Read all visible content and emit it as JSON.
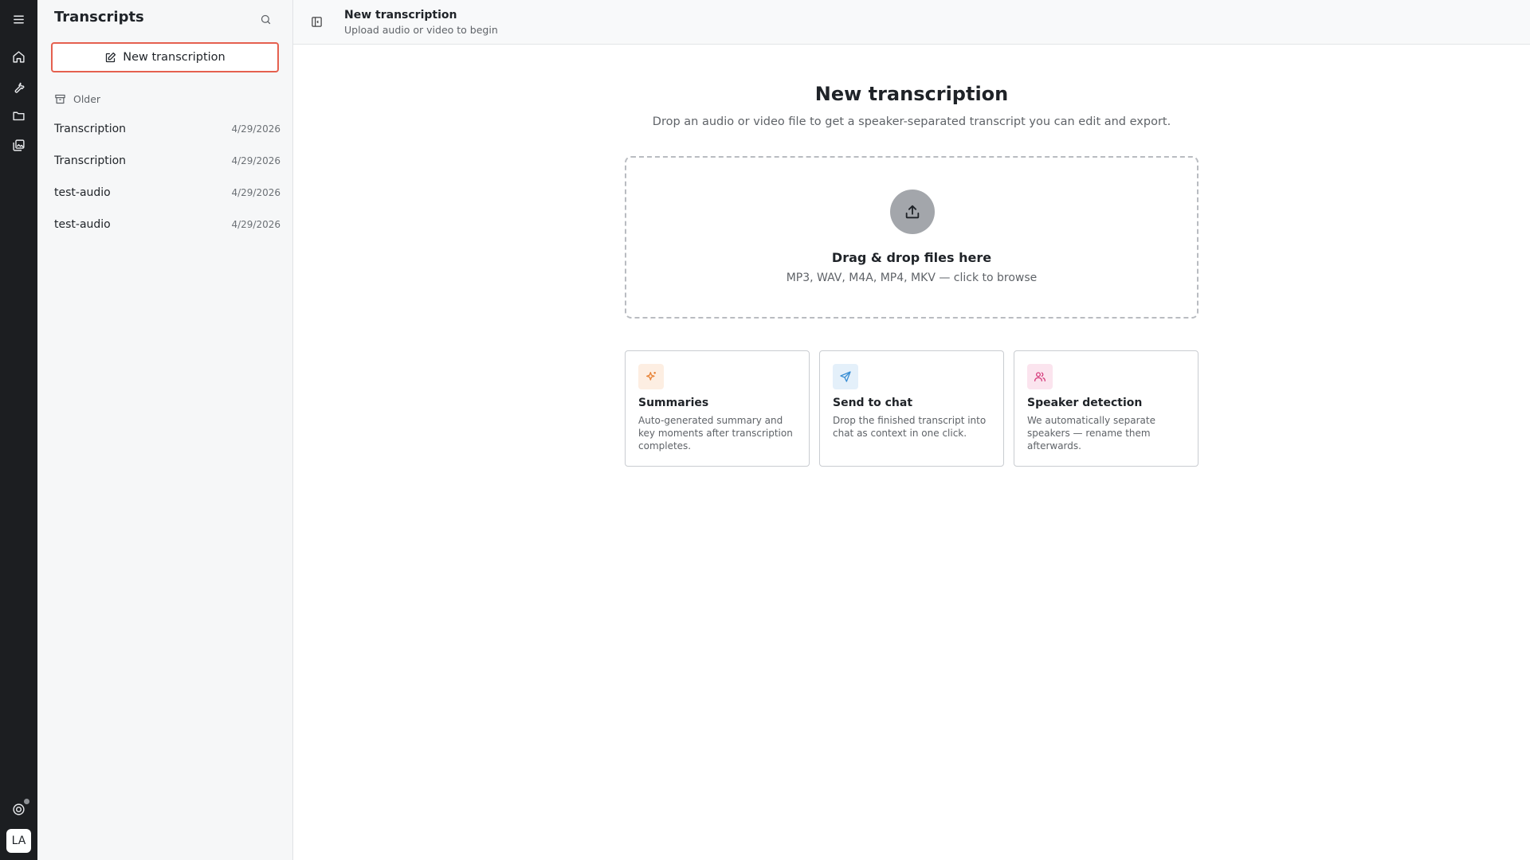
{
  "rail": {
    "icons": [
      "menu-icon",
      "home-icon",
      "tools-icon",
      "folder-icon",
      "gallery-icon",
      "support-icon"
    ],
    "avatar_initials": "LA"
  },
  "sidebar": {
    "title": "Transcripts",
    "new_button_label": "New transcription",
    "group_label": "Older",
    "items": [
      {
        "name": "Transcription",
        "date": "4/29/2026"
      },
      {
        "name": "Transcription",
        "date": "4/29/2026"
      },
      {
        "name": "test-audio",
        "date": "4/29/2026"
      },
      {
        "name": "test-audio",
        "date": "4/29/2026"
      }
    ]
  },
  "header": {
    "title": "New transcription",
    "subtitle": "Upload audio or video to begin"
  },
  "main": {
    "title": "New transcription",
    "subtitle": "Drop an audio or video file to get a speaker-separated transcript you can edit and export.",
    "dropzone": {
      "title": "Drag & drop files here",
      "subtitle": "MP3, WAV, M4A, MP4, MKV — click to browse"
    },
    "features": [
      {
        "title": "Summaries",
        "description": "Auto-generated summary and key moments after transcription completes.",
        "icon": "sparkles-icon",
        "color": "#e8853a",
        "bg": "#fdeee2"
      },
      {
        "title": "Send to chat",
        "description": "Drop the finished transcript into chat as context in one click.",
        "icon": "send-icon",
        "color": "#3b8fd4",
        "bg": "#e4f0fa"
      },
      {
        "title": "Speaker detection",
        "description": "We automatically separate speakers — rename them afterwards.",
        "icon": "users-icon",
        "color": "#d63e7d",
        "bg": "#fbe4ee"
      }
    ]
  },
  "colors": {
    "accent_border": "#e5604f",
    "rail_bg": "#1c1e21"
  }
}
